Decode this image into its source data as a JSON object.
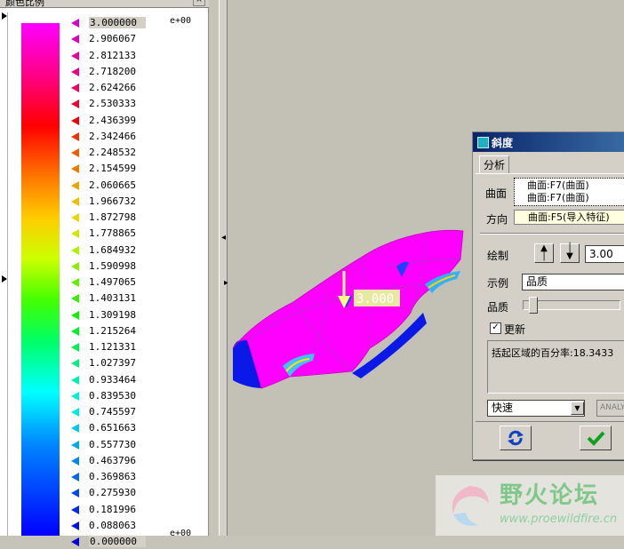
{
  "scale_panel": {
    "title": "颜色比例",
    "close_label": "×",
    "exponent_top": "e+00",
    "exponent_bottom": "e+00",
    "ticks": [
      {
        "value": "3.000000",
        "color": "#d400d4"
      },
      {
        "value": "2.906067",
        "color": "#e000c0"
      },
      {
        "value": "2.812133",
        "color": "#e800a0"
      },
      {
        "value": "2.718200",
        "color": "#ee0080"
      },
      {
        "value": "2.624266",
        "color": "#f00060"
      },
      {
        "value": "2.530333",
        "color": "#f00030"
      },
      {
        "value": "2.436399",
        "color": "#f00000"
      },
      {
        "value": "2.342466",
        "color": "#f03000"
      },
      {
        "value": "2.248532",
        "color": "#f05a00"
      },
      {
        "value": "2.154599",
        "color": "#f07a00"
      },
      {
        "value": "2.060665",
        "color": "#f0a000"
      },
      {
        "value": "1.966732",
        "color": "#f0c000"
      },
      {
        "value": "1.872798",
        "color": "#e8d800"
      },
      {
        "value": "1.778865",
        "color": "#d0e800"
      },
      {
        "value": "1.684932",
        "color": "#b0f000"
      },
      {
        "value": "1.590998",
        "color": "#88f000"
      },
      {
        "value": "1.497065",
        "color": "#60f000"
      },
      {
        "value": "1.403131",
        "color": "#38f000"
      },
      {
        "value": "1.309198",
        "color": "#10f000"
      },
      {
        "value": "1.215264",
        "color": "#00f020"
      },
      {
        "value": "1.121331",
        "color": "#00f050"
      },
      {
        "value": "1.027397",
        "color": "#00f080"
      },
      {
        "value": "0.933464",
        "color": "#00f0b0"
      },
      {
        "value": "0.839530",
        "color": "#00f0d8"
      },
      {
        "value": "0.745597",
        "color": "#00e8f0"
      },
      {
        "value": "0.651663",
        "color": "#00c8f0"
      },
      {
        "value": "0.557730",
        "color": "#00a8f0"
      },
      {
        "value": "0.463796",
        "color": "#0088f0"
      },
      {
        "value": "0.369863",
        "color": "#0068f0"
      },
      {
        "value": "0.275930",
        "color": "#0048f0"
      },
      {
        "value": "0.181996",
        "color": "#0028f0"
      },
      {
        "value": "0.088063",
        "color": "#0010e8"
      },
      {
        "value": "0.000000",
        "color": "#0000d8"
      }
    ]
  },
  "viewport": {
    "model_label": "3.000"
  },
  "dialog": {
    "title": "斜度",
    "tab_analysis": "分析",
    "surface_label": "曲面",
    "surface_refs": [
      "曲面:F7(曲面)",
      "曲面:F7(曲面)"
    ],
    "direction_label": "方向",
    "direction_ref": "曲面:F5(导入特征)",
    "plot_label": "绘制",
    "plot_value": "3.00",
    "sample_label": "示例",
    "sample_value": "品质",
    "quality_label": "品质",
    "quality_level": 0.05,
    "update_label": "更新",
    "update_checked": "✓",
    "result_text": "括起区域的百分率:18.3433",
    "mode_value": "快速",
    "analysis_name": "ANALYSIS"
  },
  "watermark": {
    "name": "野火论坛",
    "url": "www.proewildfire.cn"
  }
}
